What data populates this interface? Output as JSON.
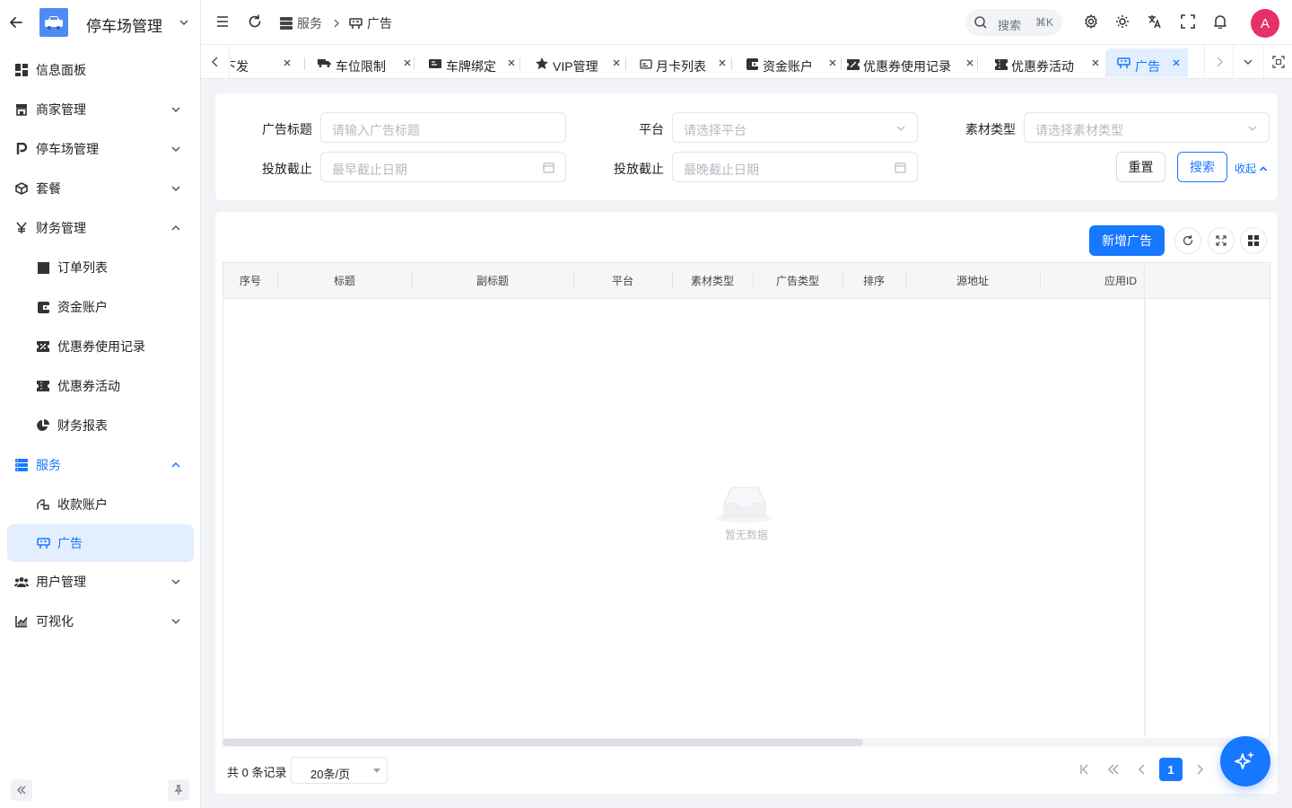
{
  "brand": {
    "title": "停车场管理"
  },
  "sidebar": {
    "items": [
      {
        "label": "信息面板",
        "icon": "dashboard-icon"
      },
      {
        "label": "商家管理",
        "icon": "store-icon"
      },
      {
        "label": "停车场管理",
        "icon": "parking-icon"
      },
      {
        "label": "套餐",
        "icon": "package-icon"
      },
      {
        "label": "财务管理",
        "icon": "yen-icon"
      },
      {
        "label": "订单列表",
        "icon": "order-icon"
      },
      {
        "label": "资金账户",
        "icon": "wallet-icon"
      },
      {
        "label": "优惠券使用记录",
        "icon": "coupon-icon"
      },
      {
        "label": "优惠券活动",
        "icon": "ticket-icon"
      },
      {
        "label": "财务报表",
        "icon": "pie-chart-icon"
      },
      {
        "label": "服务",
        "icon": "server-icon"
      },
      {
        "label": "收款账户",
        "icon": "payment-icon"
      },
      {
        "label": "广告",
        "icon": "billboard-icon"
      },
      {
        "label": "用户管理",
        "icon": "users-icon"
      },
      {
        "label": "可视化",
        "icon": "line-chart-icon"
      }
    ]
  },
  "header": {
    "breadcrumb": [
      "服务",
      "广告"
    ],
    "search_label": "搜索",
    "search_shortcut": "⌘K",
    "avatar_letter": "A"
  },
  "tabs": [
    {
      "label": "下发"
    },
    {
      "label": "车位限制"
    },
    {
      "label": "车牌绑定"
    },
    {
      "label": "VIP管理"
    },
    {
      "label": "月卡列表"
    },
    {
      "label": "资金账户"
    },
    {
      "label": "优惠券使用记录"
    },
    {
      "label": "优惠券活动"
    },
    {
      "label": "广告"
    }
  ],
  "filter": {
    "ad_title_label": "广告标题",
    "ad_title_placeholder": "请输入广告标题",
    "platform_label": "平台",
    "platform_placeholder": "请选择平台",
    "material_label": "素材类型",
    "material_placeholder": "请选择素材类型",
    "start_label": "投放截止",
    "start_placeholder": "最早截止日期",
    "end_label": "投放截止",
    "end_placeholder": "最晚截止日期",
    "reset_label": "重置",
    "search_label": "搜索",
    "collapse_label": "收起"
  },
  "table": {
    "add_label": "新增广告",
    "columns": [
      "序号",
      "标题",
      "副标题",
      "平台",
      "素材类型",
      "广告类型",
      "排序",
      "源地址",
      "应用ID"
    ],
    "empty_text": "暂无数据",
    "rows": []
  },
  "pagination": {
    "total_text": "共 0 条记录",
    "page_size": "20条/页",
    "current_page": "1"
  },
  "colors": {
    "accent": "#1677ff",
    "avatar": "#e5306a",
    "active_bg": "#e3eefe"
  }
}
